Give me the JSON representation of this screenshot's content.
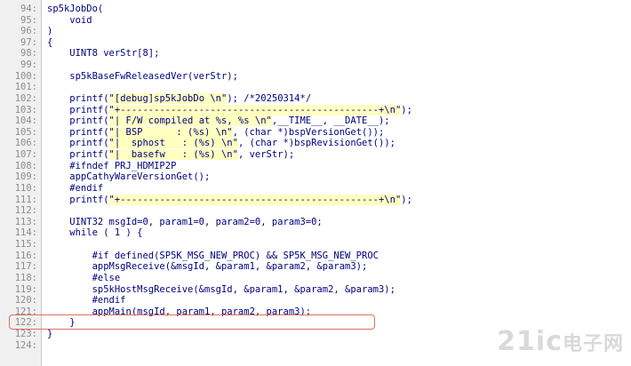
{
  "editor": {
    "lines": [
      {
        "n": "94:",
        "text": "sp5kJobDo("
      },
      {
        "n": "95:",
        "text": "    void"
      },
      {
        "n": "96:",
        "text": ")"
      },
      {
        "n": "97:",
        "text": "{"
      },
      {
        "n": "98:",
        "text": "    UINT8 verStr[8];"
      },
      {
        "n": "99:",
        "text": ""
      },
      {
        "n": "100:",
        "text": "    sp5kBaseFwReleasedVer(verStr);"
      },
      {
        "n": "101:",
        "text": ""
      },
      {
        "n": "102:",
        "text": "    printf(\"[debug]sp5kJobDo \\n\"); /*20250314*/"
      },
      {
        "n": "103:",
        "text": "    printf(\"+----------------------------------------------+\\n\");"
      },
      {
        "n": "104:",
        "text": "    printf(\"| F/W compiled at %s, %s \\n\",__TIME__, __DATE__);"
      },
      {
        "n": "105:",
        "text": "    printf(\"| BSP      : (%s) \\n\", (char *)bspVersionGet());"
      },
      {
        "n": "106:",
        "text": "    printf(\"|  sphost   : (%s) \\n\", (char *)bspRevisionGet());"
      },
      {
        "n": "107:",
        "text": "    printf(\"|  basefw   : (%s) \\n\", verStr);"
      },
      {
        "n": "108:",
        "text": "    #ifndef PRJ_HDMIP2P"
      },
      {
        "n": "109:",
        "text": "    appCathyWareVersionGet();"
      },
      {
        "n": "110:",
        "text": "    #endif"
      },
      {
        "n": "111:",
        "text": "    printf(\"+----------------------------------------------+\\n\");"
      },
      {
        "n": "112:",
        "text": ""
      },
      {
        "n": "113:",
        "text": "    UINT32 msgId=0, param1=0, param2=0, param3=0;"
      },
      {
        "n": "114:",
        "text": "    while ( 1 ) {"
      },
      {
        "n": "115:",
        "text": ""
      },
      {
        "n": "116:",
        "text": "        #if defined(SP5K_MSG_NEW_PROC) && SP5K_MSG_NEW_PROC"
      },
      {
        "n": "117:",
        "text": "        appMsgReceive(&msgId, &param1, &param2, &param3);"
      },
      {
        "n": "118:",
        "text": "        #else"
      },
      {
        "n": "119:",
        "text": "        sp5kHostMsgReceive(&msgId, &param1, &param2, &param3);"
      },
      {
        "n": "120:",
        "text": "        #endif"
      },
      {
        "n": "121:",
        "text": "        appMain(msgId, param1, param2, param3);"
      },
      {
        "n": "122:",
        "text": "    }"
      },
      {
        "n": "123:",
        "text": "}"
      },
      {
        "n": "124:",
        "text": ""
      }
    ]
  },
  "watermark": {
    "text": "21ic",
    "sub": "电子网"
  },
  "colors": {
    "gutter": "#f0f0f0",
    "code": "#000080",
    "string_bg": "#ffffc0",
    "highlight_border": "#e07060"
  }
}
